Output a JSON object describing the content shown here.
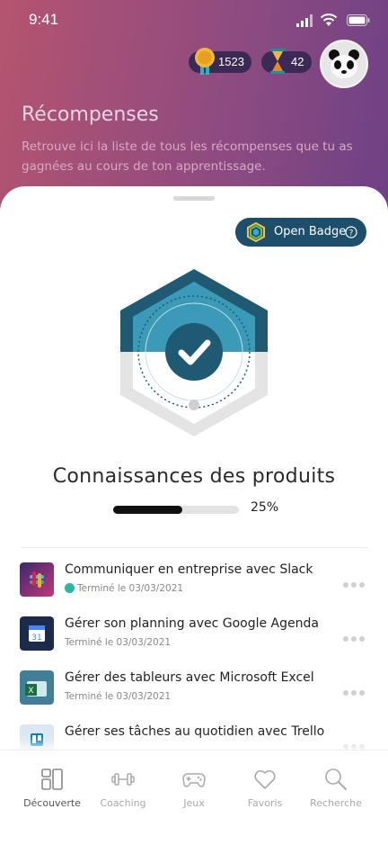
{
  "status": {
    "time": "9:41"
  },
  "header": {
    "medals": "1523",
    "hourglass": "42",
    "title": "Récompenses",
    "subtitle": "Retrouve ici la liste de tous les récompenses que tu as gagnées au cours de ton apprentissage."
  },
  "open_badge": {
    "label": "Open Badge"
  },
  "course": {
    "title": "Connaissances des produits",
    "progress_label": "25%",
    "progress_value": 0.55
  },
  "items": [
    {
      "title": "Communiquer en entreprise avec Slack",
      "subtitle": "Terminé le 03/03/2021",
      "checked": true,
      "icon": "slack-icon"
    },
    {
      "title": "Gérer son planning avec Google Agenda",
      "subtitle": "Terminé le 03/03/2021",
      "checked": false,
      "icon": "google-calendar-icon"
    },
    {
      "title": "Gérer des tableurs avec Microsoft Excel",
      "subtitle": "Terminé le 03/03/2021",
      "checked": false,
      "icon": "excel-icon"
    },
    {
      "title": "Gérer ses tâches au quotidien avec Trello",
      "subtitle": "",
      "checked": false,
      "icon": "trello-icon"
    }
  ],
  "tabs": [
    {
      "label": "Découverte",
      "icon": "discover-icon",
      "active": true
    },
    {
      "label": "Coaching",
      "icon": "dumbbell-icon",
      "active": false
    },
    {
      "label": "Jeux",
      "icon": "gamepad-icon",
      "active": false
    },
    {
      "label": "Favoris",
      "icon": "heart-icon",
      "active": false
    },
    {
      "label": "Recherche",
      "icon": "search-icon",
      "active": false
    }
  ],
  "colors": {
    "primary": "#1d4e6b",
    "accent": "#2d8bab",
    "check": "#29b6a6"
  }
}
